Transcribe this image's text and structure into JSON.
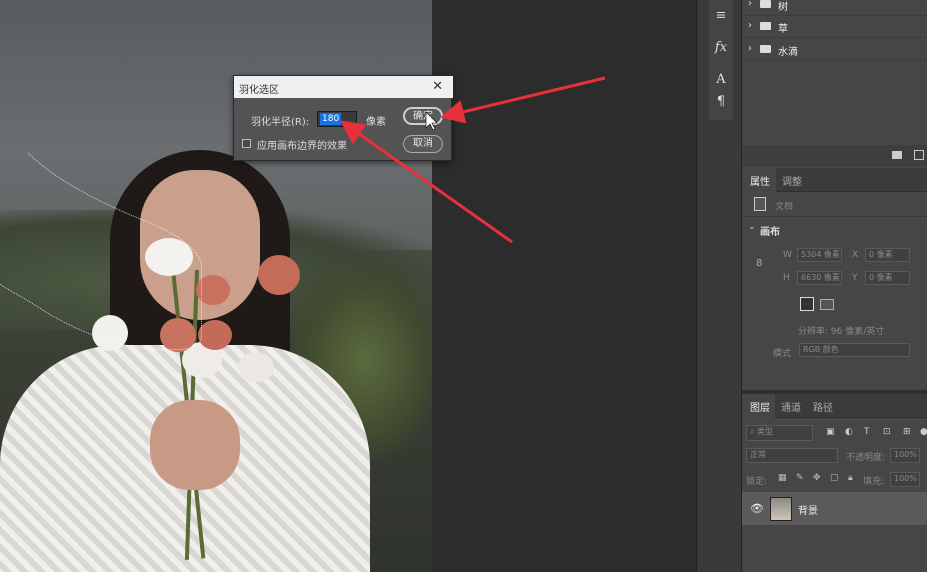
{
  "layers_panel_top": {
    "items": [
      {
        "label": "树"
      },
      {
        "label": "草"
      },
      {
        "label": "水滴"
      }
    ]
  },
  "properties": {
    "tabs": [
      "属性",
      "调整"
    ],
    "doc_label": "文档",
    "section": "画布",
    "w_label": "W",
    "w_value": "5304 像素",
    "h_label": "H",
    "h_value": "6630 像素",
    "x_label": "X",
    "x_value": "0 像素",
    "y_label": "Y",
    "y_value": "0 像素",
    "resolution": "分辨率: 96 像素/英寸",
    "mode_label": "模式",
    "mode_value": "RGB 颜色"
  },
  "layers": {
    "tabs": [
      "图层",
      "通道",
      "路径"
    ],
    "filter_placeholder": "类型",
    "blend_mode": "正常",
    "opacity_label": "不透明度:",
    "opacity_value": "100%",
    "lock_label": "锁定:",
    "fill_label": "填充:",
    "fill_value": "100%",
    "layer_name": "背景"
  },
  "dialog": {
    "title": "羽化选区",
    "radius_label": "羽化半径(R):",
    "radius_value": "180",
    "unit": "像素",
    "apply_edge_label": "应用画布边界的效果",
    "ok_label": "确定",
    "cancel_label": "取消"
  },
  "colors": {
    "accent": "#1473e6",
    "annotation_arrow": "#e8303a"
  }
}
